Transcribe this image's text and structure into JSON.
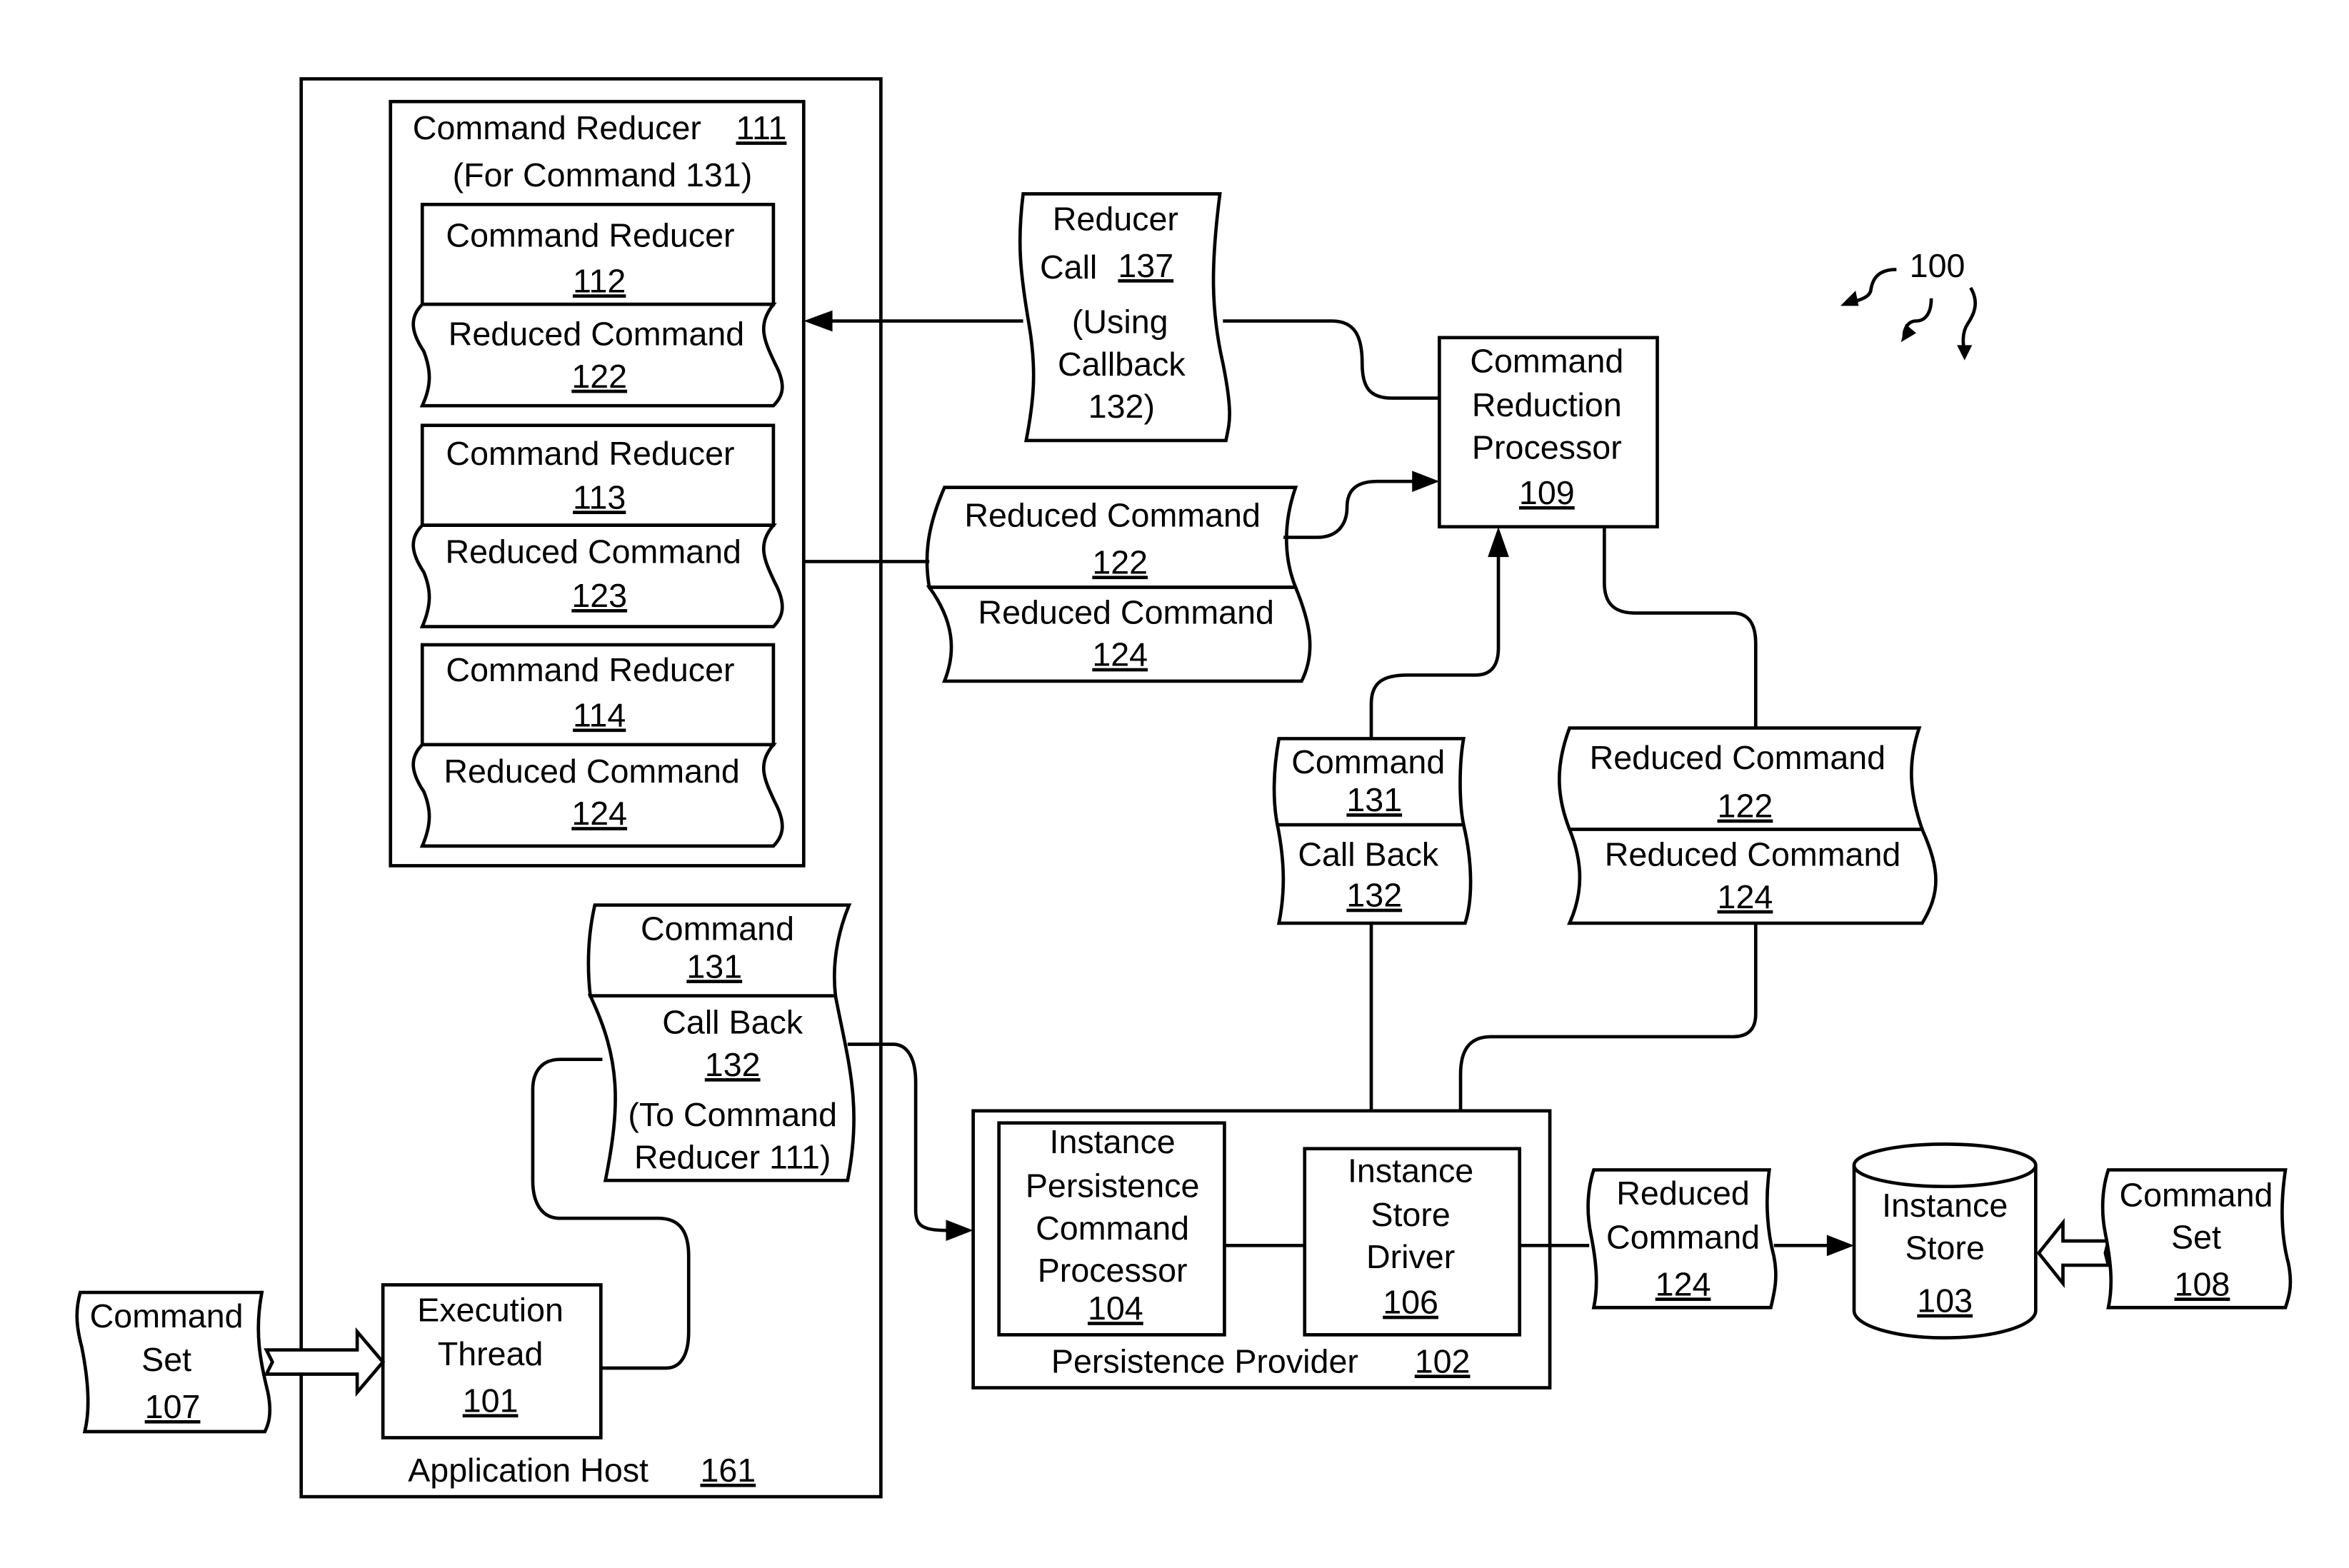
{
  "figure_ref": "100",
  "application_host": {
    "label": "Application Host",
    "ref": "161"
  },
  "command_reducer_111": {
    "label": "Command Reducer",
    "ref": "111",
    "subtitle": "(For Command 131)"
  },
  "reducer_pairs": [
    {
      "reducer_label": "Command Reducer",
      "reducer_ref": "112",
      "reduced_label": "Reduced Command",
      "reduced_ref": "122"
    },
    {
      "reducer_label": "Command Reducer",
      "reducer_ref": "113",
      "reduced_label": "Reduced Command",
      "reduced_ref": "123"
    },
    {
      "reducer_label": "Command Reducer",
      "reducer_ref": "114",
      "reduced_label": "Reduced Command",
      "reduced_ref": "124"
    }
  ],
  "reducer_call": {
    "line1": "Reducer",
    "line2": "Call",
    "ref": "137",
    "line3": "(Using",
    "line4": "Callback",
    "line5": "132)"
  },
  "command_reduction_processor": {
    "line1": "Command",
    "line2": "Reduction",
    "line3": "Processor",
    "ref": "109"
  },
  "reduced_pair_mid": [
    {
      "label": "Reduced Command",
      "ref": "122"
    },
    {
      "label": "Reduced Command",
      "ref": "124"
    }
  ],
  "command_callback_right": {
    "command_label": "Command",
    "command_ref": "131",
    "callback_label": "Call Back",
    "callback_ref": "132"
  },
  "reduced_pair_right": [
    {
      "label": "Reduced Command",
      "ref": "122"
    },
    {
      "label": "Reduced Command",
      "ref": "124"
    }
  ],
  "command_callback_left": {
    "command_label": "Command",
    "command_ref": "131",
    "callback_label": "Call Back",
    "callback_ref": "132",
    "note1": "(To Command",
    "note2": "Reducer 111)"
  },
  "execution_thread": {
    "line1": "Execution",
    "line2": "Thread",
    "ref": "101"
  },
  "command_set_107": {
    "line1": "Command",
    "line2": "Set",
    "ref": "107"
  },
  "persistence_provider": {
    "label": "Persistence Provider",
    "ref": "102"
  },
  "ipcp": {
    "line1": "Instance",
    "line2": "Persistence",
    "line3": "Command",
    "line4": "Processor",
    "ref": "104"
  },
  "store_driver": {
    "line1": "Instance",
    "line2": "Store",
    "line3": "Driver",
    "ref": "106"
  },
  "reduced_command_out": {
    "line1": "Reduced",
    "line2": "Command",
    "ref": "124"
  },
  "instance_store": {
    "line1": "Instance",
    "line2": "Store",
    "ref": "103"
  },
  "command_set_108": {
    "line1": "Command",
    "line2": "Set",
    "ref": "108"
  }
}
